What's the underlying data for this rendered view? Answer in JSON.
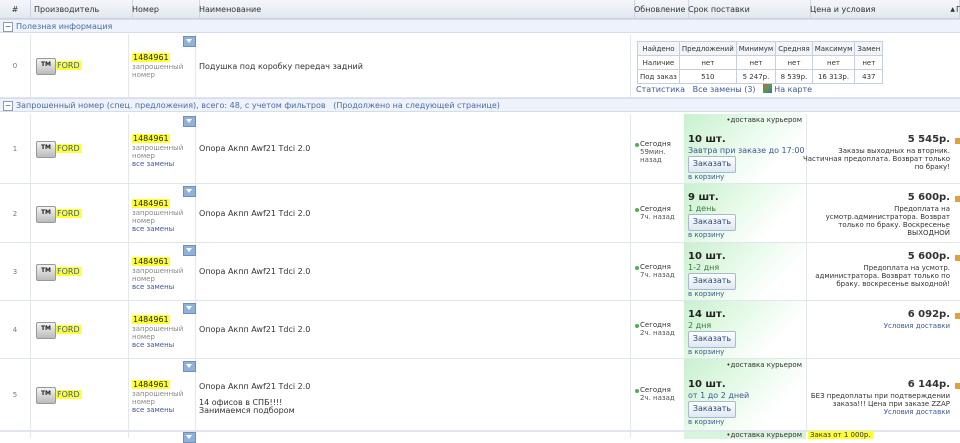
{
  "header": {
    "col_num": "#",
    "col_manufacturer": "Производитель",
    "col_number": "Номер",
    "col_name": "Наименование",
    "col_update": "Обновление",
    "col_delivery": "Срок поставки",
    "col_price": "Цена и условия",
    "sort_icon": "triangle-up-icon",
    "col_edge": "Г"
  },
  "group1": {
    "toggle": "−",
    "label": "Полезная информация"
  },
  "info_row": {
    "num": "0",
    "logo": "TM",
    "brand": "FORD",
    "part_number": "1484961",
    "part_sub": "запрошенный номер",
    "name": "Подушка под коробку передач задний",
    "stats": {
      "headers": [
        "Найдено",
        "Предложений",
        "Минимум",
        "Средняя",
        "Максимум",
        "Замен"
      ],
      "row1": [
        "Наличие",
        "нет",
        "нет",
        "нет",
        "нет",
        "нет"
      ],
      "row2": [
        "Под заказ",
        "510",
        "5 247р.",
        "8 539р.",
        "16 313р.",
        "437"
      ]
    },
    "link_stats": "Статистика",
    "link_replacements": "Все замены (3)",
    "link_map": "На карте"
  },
  "group2": {
    "toggle": "−",
    "label": "Запрошенный номер (спец. предложения), всего: 48, с учетом фильтров",
    "note": "(Продолжено на следующей странице)"
  },
  "rows": [
    {
      "num": "1",
      "brand": "FORD",
      "pn": "1484961",
      "sub": "запрошенный номер",
      "all": "все замены",
      "name": "Опора Акпп Awf21 Tdci 2.0",
      "extra1": "",
      "extra2": "",
      "upd_day": "Сегодня",
      "upd_ago": "59мин. назад",
      "courier": "•доставка курьером",
      "qty": "10 шт.",
      "term": "Завтра при заказе до 17:00",
      "order": "Заказать",
      "cart": "в корзину",
      "price": "5 545р.",
      "cond": "Заказы выходных на вторник. Частичная предоплата. Возврат только по браку!"
    },
    {
      "num": "2",
      "brand": "FORD",
      "pn": "1484961",
      "sub": "запрошенный номер",
      "all": "все замены",
      "name": "Опора Акпп Awf21 Tdci 2.0",
      "extra1": "",
      "extra2": "",
      "upd_day": "Сегодня",
      "upd_ago": "7ч. назад",
      "courier": "",
      "qty": "9 шт.",
      "term": "1 день",
      "order": "Заказать",
      "cart": "в корзину",
      "price": "5 600р.",
      "cond": "Предоплата на усмотр.администратора. Возврат только по браку. Воскресенье ВЫХОДНОЙ"
    },
    {
      "num": "3",
      "brand": "FORD",
      "pn": "1484961",
      "sub": "запрошенный номер",
      "all": "все замены",
      "name": "Опора Акпп Awf21 Tdci 2.0",
      "extra1": "",
      "extra2": "",
      "upd_day": "Сегодня",
      "upd_ago": "7ч. назад",
      "courier": "",
      "qty": "10 шт.",
      "term": "1-2 дня",
      "order": "Заказать",
      "cart": "в корзину",
      "price": "5 600р.",
      "cond": "Предоплата на усмотр. администратора. Возврат только по браку. воскресенье выходной!"
    },
    {
      "num": "4",
      "brand": "FORD",
      "pn": "1484961",
      "sub": "запрошенный номер",
      "all": "все замены",
      "name": "Опора Акпп Awf21 Tdci 2.0",
      "extra1": "",
      "extra2": "",
      "upd_day": "Сегодня",
      "upd_ago": "2ч. назад",
      "courier": "",
      "qty": "14 шт.",
      "term": "2 дня",
      "order": "Заказать",
      "cart": "в корзину",
      "price": "6 092р.",
      "cond": "Условия доставки"
    },
    {
      "num": "5",
      "brand": "FORD",
      "pn": "1484961",
      "sub": "запрошенный номер",
      "all": "все замены",
      "name": "Опора Акпп Awf21 Tdci 2.0",
      "extra1": "14 офисов в СПБ!!!!",
      "extra2": "Занимаемся подбором",
      "upd_day": "Сегодня",
      "upd_ago": "2ч. назад",
      "courier": "•доставка курьером",
      "qty": "10 шт.",
      "term": "от 1 до 2 дней",
      "order": "Заказать",
      "cart": "в корзину",
      "price": "6 144р.",
      "cond": "БЕЗ предоплаты при подтверждении заказа!!! Цена при заказе ZZAP",
      "cond2": "Условия доставки"
    }
  ],
  "next_row": {
    "courier": "•доставка курьером",
    "zzap": "Заказ от 1 000р."
  }
}
